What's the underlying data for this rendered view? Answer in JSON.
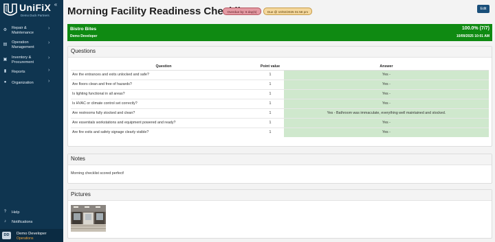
{
  "app": {
    "logo_text": "UniFiX",
    "logo_sub": "Demo Duck Partners"
  },
  "sidebar": {
    "items": [
      {
        "label": "Repair & Maintenance",
        "icon": "gear-icon"
      },
      {
        "label": "Operation Management",
        "icon": "clipboard-icon"
      },
      {
        "label": "Inventory & Procurement",
        "icon": "box-icon"
      },
      {
        "label": "Reports",
        "icon": "bar-chart-icon"
      },
      {
        "label": "Organization",
        "icon": "people-icon"
      }
    ],
    "bottom": [
      {
        "label": "Help",
        "icon": "help-icon"
      },
      {
        "label": "Notifications",
        "icon": "bell-icon"
      }
    ],
    "user": {
      "initials": "DD",
      "name": "Demo Developer",
      "role": "Operations"
    }
  },
  "header": {
    "title": "Morning Facility Readiness Checklist",
    "overdue_badge": "Overdue by: 6 day(s)",
    "due_badge": "Due @ 10/02/2025 01:58 pm",
    "edit_label": "Edit"
  },
  "banner": {
    "location": "Bistro Bites",
    "score": "100.0% (7/7)",
    "user": "Demo Developer",
    "datetime": "10/09/2025 10:01 AM",
    "color": "#0f8a12"
  },
  "questions": {
    "title": "Questions",
    "columns": [
      "Question",
      "Point value",
      "Answer"
    ],
    "rows": [
      {
        "question": "Are the entrances and exits unlocked and safe?",
        "points": "1",
        "answer": "Yes -"
      },
      {
        "question": "Are floors clean and free of hazards?",
        "points": "1",
        "answer": "Yes -"
      },
      {
        "question": "Is lighting functional in all areas?",
        "points": "1",
        "answer": "Yes -"
      },
      {
        "question": "Is HVAC or climate control set correctly?",
        "points": "1",
        "answer": "Yes -"
      },
      {
        "question": "Are restrooms fully stocked and clean?",
        "points": "1",
        "answer": "Yes - Bathroom was immaculate, everything well maintained and stocked."
      },
      {
        "question": "Are essentials workstations and equipment powered and ready?",
        "points": "1",
        "answer": "Yes -"
      },
      {
        "question": "Are fire exits and safety signage clearly visible?",
        "points": "1",
        "answer": "Yes -"
      }
    ]
  },
  "notes": {
    "title": "Notes",
    "text": "Morning checklist scored perfect!"
  },
  "pictures": {
    "title": "Pictures"
  }
}
